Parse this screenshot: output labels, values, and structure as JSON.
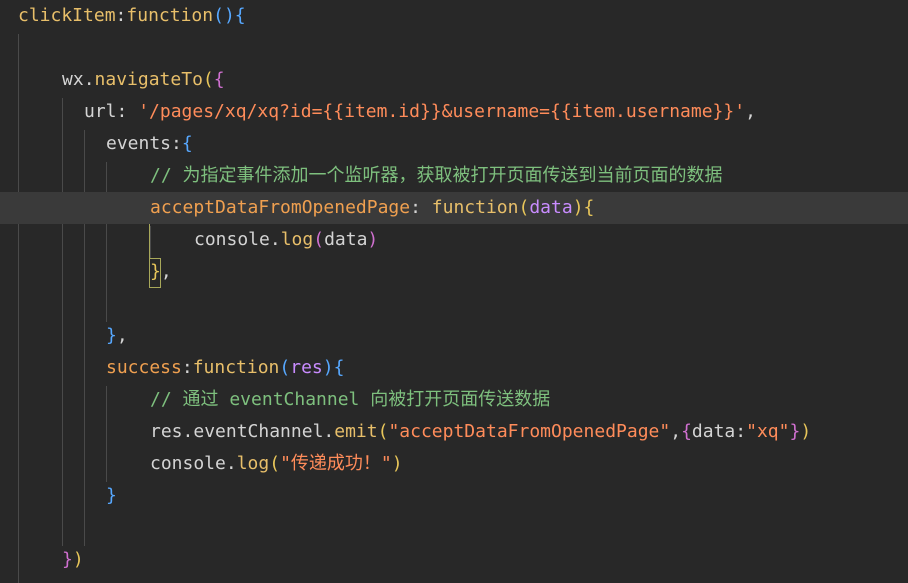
{
  "code_lines": [
    {
      "tokens": [
        {
          "t": "clickItem",
          "c": "#e8bf6a"
        },
        {
          "t": ":",
          "c": "#d4d4d4"
        },
        {
          "t": "function",
          "c": "#e8bf6a"
        },
        {
          "t": "(",
          "c": "#57a8ff"
        },
        {
          "t": ")",
          "c": "#57a8ff"
        },
        {
          "t": "{",
          "c": "#57a8ff"
        }
      ]
    },
    {
      "tokens": []
    },
    {
      "tokens": []
    },
    {
      "tokens": [
        {
          "t": "wx",
          "c": "#d4d4d4"
        },
        {
          "t": ".",
          "c": "#d4d4d4"
        },
        {
          "t": "navigateTo",
          "c": "#e8bf6a"
        },
        {
          "t": "(",
          "c": "#e8c65a"
        },
        {
          "t": "{",
          "c": "#d070d0"
        }
      ]
    },
    {
      "tokens": [
        {
          "t": "url",
          "c": "#d4d4d4"
        },
        {
          "t": ": ",
          "c": "#d4d4d4"
        },
        {
          "t": "'/pages/xq/xq?id={{item.id}}&username={{item.username}}'",
          "c": "#ff8c5a"
        },
        {
          "t": ",",
          "c": "#d4d4d4"
        }
      ]
    },
    {
      "tokens": [
        {
          "t": "events",
          "c": "#d4d4d4"
        },
        {
          "t": ":",
          "c": "#d4d4d4"
        },
        {
          "t": "{",
          "c": "#57a8ff"
        }
      ]
    },
    {
      "tokens": [
        {
          "t": "// 为指定事件添加一个监听器，获取被打开页面传送到当前页面的数据",
          "c": "#7ec07e"
        }
      ]
    },
    {
      "tokens": [
        {
          "t": "acceptDataFromOpenedPage",
          "c": "#f0a050"
        },
        {
          "t": ": ",
          "c": "#d4d4d4"
        },
        {
          "t": "function",
          "c": "#e8bf6a"
        },
        {
          "t": "(",
          "c": "#e8c65a"
        },
        {
          "t": "data",
          "c": "#c98cff"
        },
        {
          "t": ")",
          "c": "#e8c65a"
        },
        {
          "t": "{",
          "c": "#e8c65a"
        }
      ]
    },
    {
      "tokens": [
        {
          "t": "console",
          "c": "#d4d4d4"
        },
        {
          "t": ".",
          "c": "#d4d4d4"
        },
        {
          "t": "log",
          "c": "#e8bf6a"
        },
        {
          "t": "(",
          "c": "#d070d0"
        },
        {
          "t": "data",
          "c": "#d4d4d4"
        },
        {
          "t": ")",
          "c": "#d070d0"
        }
      ]
    },
    {
      "tokens": [
        {
          "t": "}",
          "c": "#e8c65a"
        },
        {
          "t": ",",
          "c": "#d4d4d4"
        }
      ]
    },
    {
      "tokens": []
    },
    {
      "tokens": [
        {
          "t": "}",
          "c": "#57a8ff"
        },
        {
          "t": ",",
          "c": "#d4d4d4"
        }
      ]
    },
    {
      "tokens": [
        {
          "t": "success",
          "c": "#f0a050"
        },
        {
          "t": ":",
          "c": "#d4d4d4"
        },
        {
          "t": "function",
          "c": "#e8bf6a"
        },
        {
          "t": "(",
          "c": "#57a8ff"
        },
        {
          "t": "res",
          "c": "#c98cff"
        },
        {
          "t": ")",
          "c": "#57a8ff"
        },
        {
          "t": "{",
          "c": "#57a8ff"
        }
      ]
    },
    {
      "tokens": [
        {
          "t": "// 通过 eventChannel 向被打开页面传送数据",
          "c": "#7ec07e"
        }
      ]
    },
    {
      "tokens": [
        {
          "t": "res",
          "c": "#d4d4d4"
        },
        {
          "t": ".",
          "c": "#d4d4d4"
        },
        {
          "t": "eventChannel",
          "c": "#d4d4d4"
        },
        {
          "t": ".",
          "c": "#d4d4d4"
        },
        {
          "t": "emit",
          "c": "#e8bf6a"
        },
        {
          "t": "(",
          "c": "#e8c65a"
        },
        {
          "t": "\"acceptDataFromOpenedPage\"",
          "c": "#ff8c5a"
        },
        {
          "t": ",",
          "c": "#d4d4d4"
        },
        {
          "t": "{",
          "c": "#d070d0"
        },
        {
          "t": "data",
          "c": "#d4d4d4"
        },
        {
          "t": ":",
          "c": "#d4d4d4"
        },
        {
          "t": "\"xq\"",
          "c": "#ff8c5a"
        },
        {
          "t": "}",
          "c": "#d070d0"
        },
        {
          "t": ")",
          "c": "#e8c65a"
        }
      ]
    },
    {
      "tokens": [
        {
          "t": "console",
          "c": "#d4d4d4"
        },
        {
          "t": ".",
          "c": "#d4d4d4"
        },
        {
          "t": "log",
          "c": "#e8bf6a"
        },
        {
          "t": "(",
          "c": "#e8c65a"
        },
        {
          "t": "\"传递成功！\"",
          "c": "#ff8c5a"
        },
        {
          "t": ")",
          "c": "#e8c65a"
        }
      ]
    },
    {
      "tokens": [
        {
          "t": "}",
          "c": "#57a8ff"
        }
      ]
    },
    {
      "tokens": []
    },
    {
      "tokens": [
        {
          "t": "}",
          "c": "#d070d0"
        },
        {
          "t": ")",
          "c": "#e8c65a"
        }
      ]
    }
  ],
  "colors": {
    "background": "#282828",
    "current_line": "#3a3a3a",
    "indent_guide": "#4a4a4a",
    "bracket_match_border": "#a8a85a"
  }
}
